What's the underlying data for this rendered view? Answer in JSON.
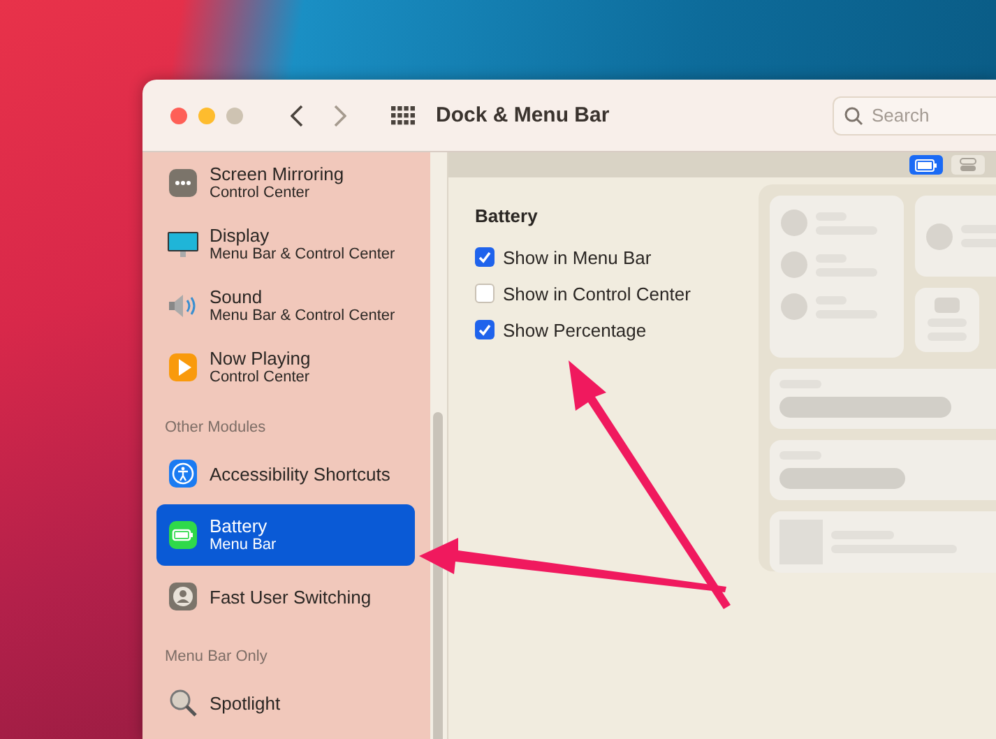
{
  "window": {
    "title": "Dock & Menu Bar",
    "search": {
      "placeholder": "Search"
    }
  },
  "sidebar": {
    "items": [
      {
        "kind": "module",
        "title": "Screen Mirroring",
        "subtitle": "Control Center",
        "selected": false
      },
      {
        "kind": "module",
        "title": "Display",
        "subtitle": "Menu Bar & Control Center",
        "selected": false
      },
      {
        "kind": "module",
        "title": "Sound",
        "subtitle": "Menu Bar & Control Center",
        "selected": false
      },
      {
        "kind": "module",
        "title": "Now Playing",
        "subtitle": "Control Center",
        "selected": false
      },
      {
        "kind": "section",
        "title": "Other Modules"
      },
      {
        "kind": "module",
        "title": "Accessibility Shortcuts",
        "selected": false
      },
      {
        "kind": "module",
        "title": "Battery",
        "subtitle": "Menu Bar",
        "selected": true
      },
      {
        "kind": "module",
        "title": "Fast User Switching",
        "selected": false
      },
      {
        "kind": "section",
        "title": "Menu Bar Only"
      },
      {
        "kind": "module",
        "title": "Spotlight",
        "selected": false
      }
    ]
  },
  "preview_modes": [
    {
      "kind": "battery",
      "selected": true
    },
    {
      "kind": "toggles",
      "selected": false
    }
  ],
  "panel": {
    "heading": "Battery",
    "options": [
      {
        "label": "Show in Menu Bar",
        "checked": true
      },
      {
        "label": "Show in Control Center",
        "checked": false
      },
      {
        "label": "Show Percentage",
        "checked": true
      }
    ]
  }
}
